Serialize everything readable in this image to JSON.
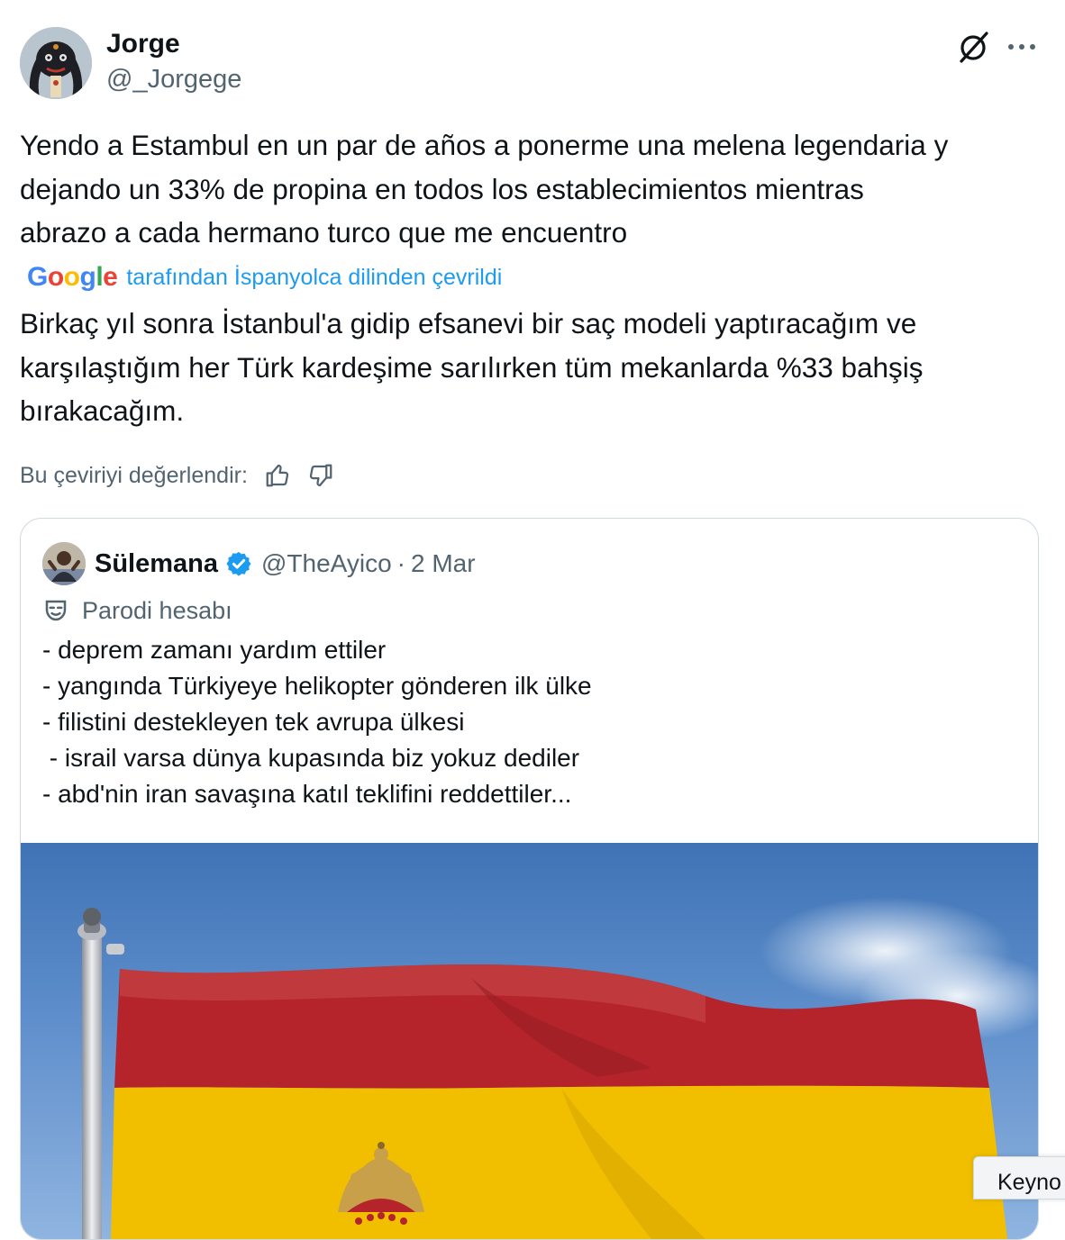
{
  "tweet": {
    "author": {
      "name": "Jorge",
      "handle": "@_Jorgege"
    },
    "original_lines": [
      "Yendo a Estambul en un par de años a ponerme una melena legendaria y",
      "dejando un 33% de propina en todos los establecimientos mientras",
      "abrazo a cada hermano turco que me encuentro"
    ],
    "translation": {
      "provider": "Google",
      "attribution": "tarafından İspanyolca dilinden çevrildi",
      "lines": [
        "Birkaç yıl sonra İstanbul'a gidip efsanevi bir saç modeli yaptıracağım ve",
        "karşılaştığım her Türk kardeşime sarılırken tüm mekanlarda %33 bahşiş",
        "bırakacağım."
      ],
      "rate_label": "Bu çeviriyi değerlendir:"
    },
    "icons": {
      "grok": "grok-icon",
      "more": "more-icon",
      "thumbs_up": "thumbs-up-icon",
      "thumbs_down": "thumbs-down-icon"
    }
  },
  "quoted_tweet": {
    "author": {
      "name": "Sülemana",
      "handle": "@TheAyico",
      "date": "2 Mar",
      "verified": true
    },
    "separator": "·",
    "parody_label": "Parodi hesabı",
    "lines": [
      "- deprem zamanı yardım ettiler",
      "- yangında Türkiyeye helikopter gönderen ilk ülke",
      "- filistini destekleyen tek avrupa ülkesi",
      " - israil varsa dünya kupasında biz yokuz dediler",
      "- abd'nin iran savaşına katıl teklifini reddettiler..."
    ],
    "media": "spanish-flag-photo"
  },
  "overlay": {
    "label": "Keyno"
  },
  "colors": {
    "text": "#0f1419",
    "secondary": "#536471",
    "link": "#1d9bf0",
    "verified": "#1d9bf0",
    "flag_red": "#b5242a",
    "flag_yellow": "#f1bf00",
    "sky": "#5f8fcc"
  }
}
